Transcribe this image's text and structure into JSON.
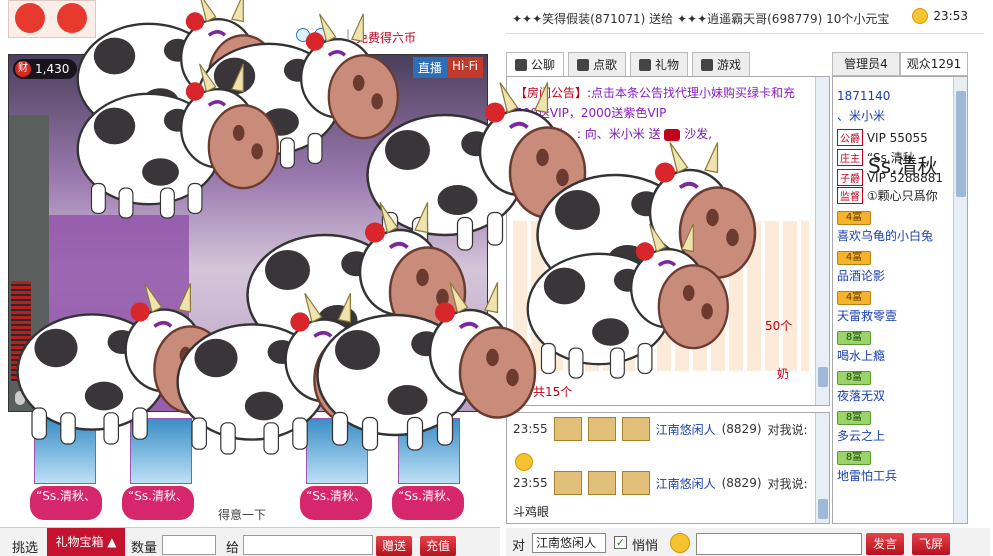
{
  "header": {
    "free_link": "免费得六币",
    "marquee_text": "✦✦✦笑得假装(871071) 送给 ✦✦✦逍遥霸天哥(698779) 10个小元宝",
    "marquee_time": "23:53"
  },
  "video": {
    "wealth_label": "财",
    "wealth_value": "1,430",
    "live_label": "直播",
    "hifi_label": "Hi-Fi",
    "pass_label": "得意一下"
  },
  "gift_slots": [
    {
      "label": "“Ss.清秋、"
    },
    {
      "label": "“Ss.清秋、"
    },
    {
      "label": "“Ss.清秋、"
    },
    {
      "label": "“Ss.清秋、"
    }
  ],
  "gift_bar": {
    "pick_label": "挑选",
    "box_label": "礼物宝箱",
    "qty_label": "数量",
    "to_label": "给",
    "give_btn": "赠送",
    "recharge_btn": "充值"
  },
  "chat": {
    "tabs": [
      {
        "label": "公聊",
        "icon": "public-chat-icon"
      },
      {
        "label": "点歌",
        "icon": "song-request-icon"
      },
      {
        "label": "礼物",
        "icon": "gift-icon"
      },
      {
        "label": "游戏",
        "icon": "game-icon"
      }
    ],
    "notice_prefix": "【房间公告】:",
    "notice_text": "点击本条公告找代理小妹购买绿卡和充",
    "notice_line2": "500送VIP，2000送紫色VIP",
    "gift_line": "“Ss.清秋、: 向、米小米 送",
    "gift_line_tail": "沙发,",
    "count_note": "50个",
    "total_note": "共15个",
    "milk_note": "奶"
  },
  "private_chat": {
    "rows": [
      {
        "time": "23:55",
        "name": "江南悠闲人",
        "id": "(8829)",
        "suffix": "对我说:"
      },
      {
        "time": "23:55",
        "name": "江南悠闲人",
        "id": "(8829)",
        "suffix": "对我说:"
      }
    ],
    "last_message": "斗鸡眼"
  },
  "input_bar": {
    "to_label": "对",
    "target": "江南悠闲人",
    "whisper_label": "悄悄",
    "send_btn": "发言",
    "fly_btn": "飞屏"
  },
  "user_list": {
    "tabs": [
      {
        "label": "管理员4"
      },
      {
        "label": "观众1291"
      }
    ],
    "top_entries": [
      {
        "text": "1871140"
      },
      {
        "text": "、米小米"
      },
      {
        "text": "VIP 55055"
      },
      {
        "text": "“Ss.清秋"
      },
      {
        "text": "VIP 5288881"
      },
      {
        "text": "①颗心只爲你"
      }
    ],
    "roles": [
      "公爵",
      "庄主",
      "子爵",
      "监督"
    ],
    "entries": [
      {
        "level": "4富",
        "name": "喜欢乌龟的小白兔",
        "color": "orange"
      },
      {
        "level": "4富",
        "name": "品酒论影",
        "color": "orange"
      },
      {
        "level": "4富",
        "name": "天雷救零壹",
        "color": "orange"
      },
      {
        "level": "8富",
        "name": "喝水上瘾",
        "color": "green"
      },
      {
        "level": "8富",
        "name": "夜落无双",
        "color": "green"
      },
      {
        "level": "8富",
        "name": "多云之上",
        "color": "green"
      },
      {
        "level": "8富",
        "name": "地雷怕工兵",
        "color": "green"
      }
    ],
    "runner_label": "Ss.清秋"
  }
}
